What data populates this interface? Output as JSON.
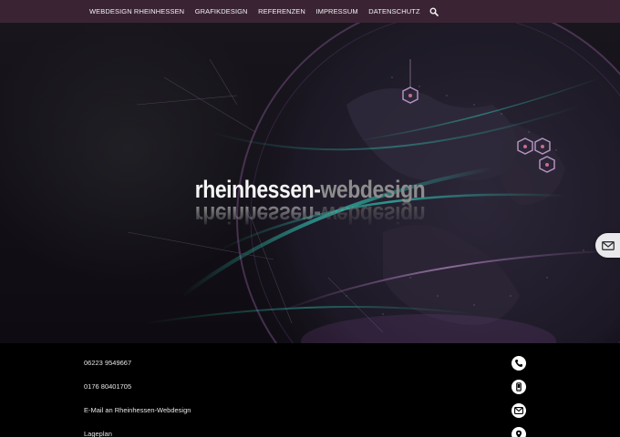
{
  "nav": {
    "items": [
      {
        "label": "WEBDESIGN RHEINHESSEN"
      },
      {
        "label": "GRAFIKDESIGN"
      },
      {
        "label": "REFERENZEN"
      },
      {
        "label": "IMPRESSUM"
      },
      {
        "label": "DATENSCHUTZ"
      }
    ],
    "search_icon": "search-icon"
  },
  "hero": {
    "brand_part1": "rheinhessen-",
    "brand_part2": "webdesign",
    "floating_icon": "mail-icon"
  },
  "contact": {
    "items": [
      {
        "label": "06223 9549667",
        "icon": "phone-icon"
      },
      {
        "label": "0176 80401705",
        "icon": "mobile-phone-icon"
      },
      {
        "label": "E-Mail an Rheinhessen-Webdesign",
        "icon": "mail-icon"
      },
      {
        "label": "Lageplan",
        "icon": "map-pin-icon"
      }
    ]
  },
  "colors": {
    "nav_bg": "#3a2434",
    "accent_teal": "#2fb8a8",
    "accent_purple": "#6a3f7a",
    "footer_bg": "#000000"
  }
}
